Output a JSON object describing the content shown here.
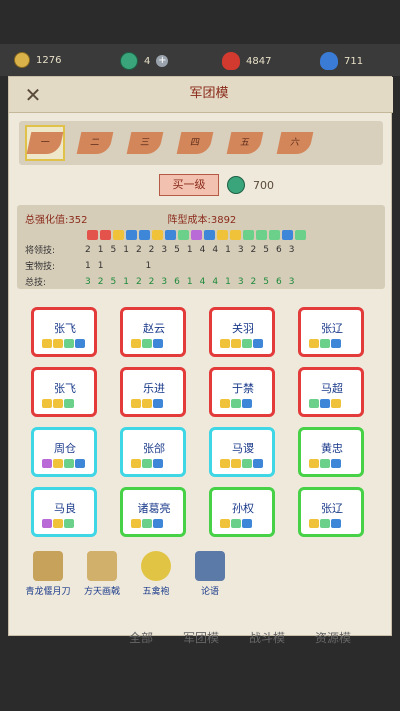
{
  "topbar": {
    "coin": "1276",
    "jade": "4",
    "fire": "4847",
    "water": "711"
  },
  "panel": {
    "title": "军团模",
    "flags": [
      "一",
      "二",
      "三",
      "四",
      "五",
      "六"
    ],
    "buy_label": "买一级",
    "price": "700",
    "stats": {
      "total_label": "总强化值:",
      "total_value": "352",
      "cost_label": "阵型成本:",
      "cost_value": "3892",
      "rows": [
        {
          "label": "将领技:",
          "values": [
            "2",
            "1",
            "5",
            "1",
            "2",
            "2",
            "3",
            "5",
            "1",
            "4",
            "4",
            "1",
            "3",
            "2",
            "5",
            "6",
            "3"
          ]
        },
        {
          "label": "宝物技:",
          "values": [
            "1",
            "1",
            "",
            "",
            "",
            "",
            "",
            "1",
            "",
            "",
            "",
            "",
            "",
            "",
            "",
            "",
            ""
          ]
        },
        {
          "label": "总技:",
          "values": [
            "3",
            "2",
            "5",
            "1",
            "2",
            "2",
            "3",
            "6",
            "1",
            "4",
            "4",
            "1",
            "3",
            "2",
            "5",
            "6",
            "3"
          ]
        }
      ]
    }
  },
  "cards": [
    {
      "name": "张飞",
      "frame": "red"
    },
    {
      "name": "赵云",
      "frame": "red"
    },
    {
      "name": "关羽",
      "frame": "red"
    },
    {
      "name": "张辽",
      "frame": "red"
    },
    {
      "name": "张飞",
      "frame": "red"
    },
    {
      "name": "乐进",
      "frame": "red"
    },
    {
      "name": "于禁",
      "frame": "red"
    },
    {
      "name": "马超",
      "frame": "red"
    },
    {
      "name": "周仓",
      "frame": "cyan"
    },
    {
      "name": "张郃",
      "frame": "cyan"
    },
    {
      "name": "马谡",
      "frame": "cyan"
    },
    {
      "name": "黄忠",
      "frame": "green"
    },
    {
      "name": "马良",
      "frame": "cyan"
    },
    {
      "name": "诸葛亮",
      "frame": "green"
    },
    {
      "name": "孙权",
      "frame": "green"
    },
    {
      "name": "张辽",
      "frame": "green"
    }
  ],
  "items": [
    {
      "label": "青龙偃月刀"
    },
    {
      "label": "方天画戟"
    },
    {
      "label": "五禽袍"
    },
    {
      "label": "论语"
    }
  ],
  "tabs": [
    "全部",
    "军团模",
    "战斗模",
    "资源模"
  ]
}
